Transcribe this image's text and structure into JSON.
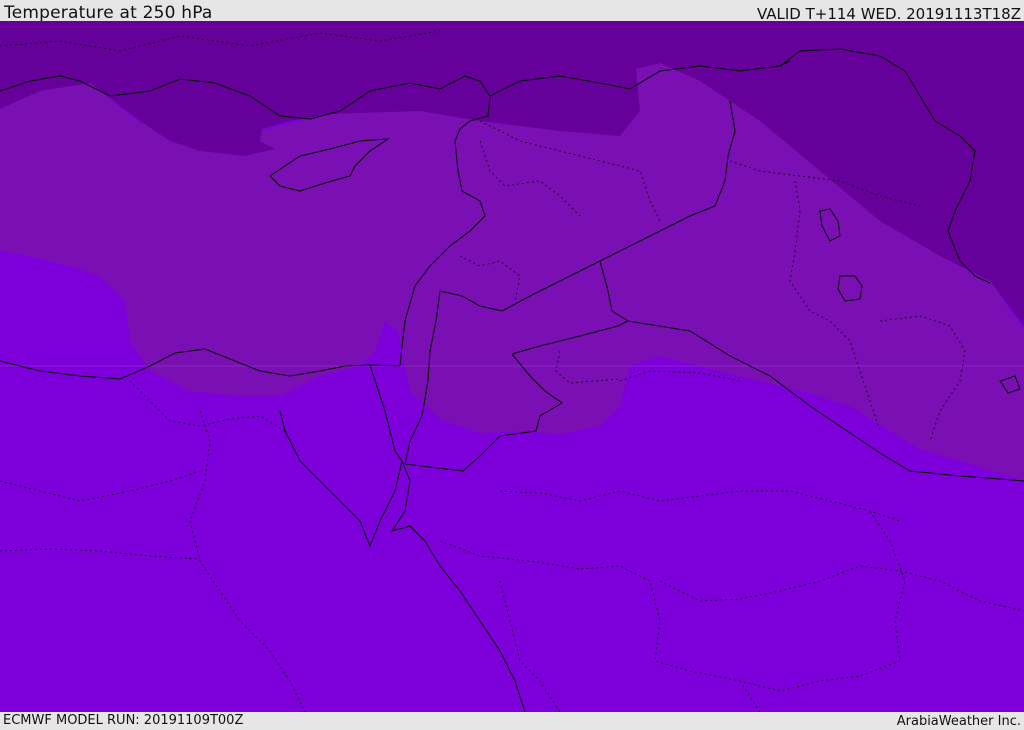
{
  "header": {
    "title": "Temperature at 250 hPa",
    "valid": "VALID T+114 WED. 20191113T18Z"
  },
  "footer": {
    "model_run": "ECMWF MODEL RUN: 20191109T00Z",
    "brand": "ArabiaWeather Inc."
  },
  "map": {
    "colors": {
      "band_cold": "#66009a",
      "band_mid": "#7a10b4",
      "band_warm": "#7d00da",
      "coastline": "#000000",
      "borders": "#000000"
    }
  }
}
